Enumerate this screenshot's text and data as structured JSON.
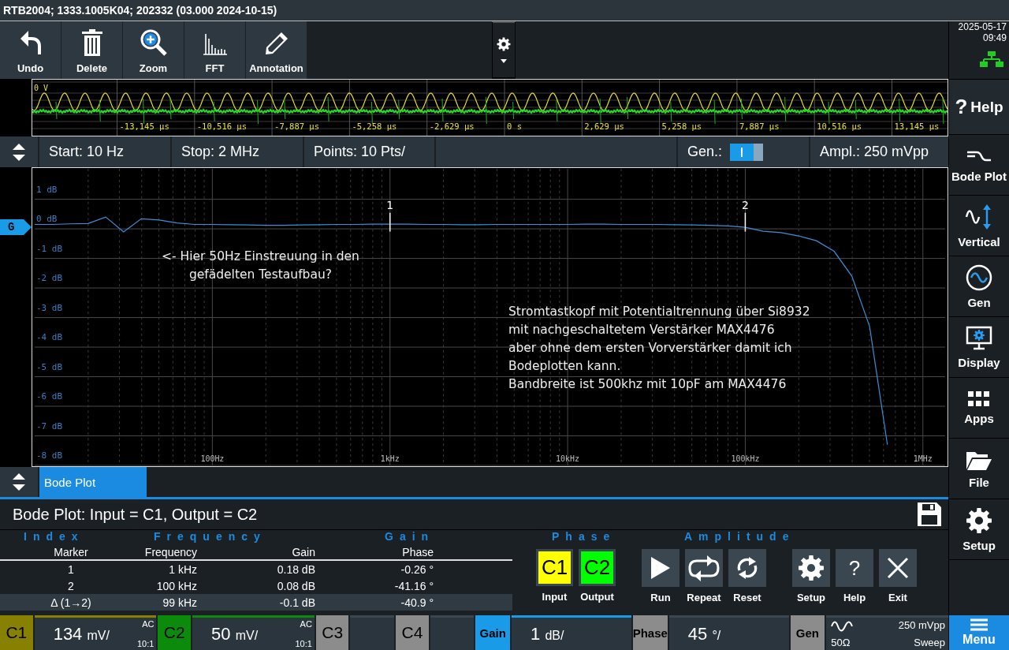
{
  "title": "RTB2004; 1333.1005K04; 202332 (03.000 2024-10-15)",
  "toolbar": {
    "buttons": [
      "Undo",
      "Delete",
      "Zoom",
      "FFT",
      "Annotation"
    ]
  },
  "overview": {
    "level_label": "0 V",
    "time_labels": [
      "-13,145 µs",
      "-10,516 µs",
      "-7,887 µs",
      "-5,258 µs",
      "-2,629 µs",
      "0 s",
      "2,629 µs",
      "5,258 µs",
      "7,887 µs",
      "10,516 µs",
      "13,145 µs"
    ]
  },
  "settings": {
    "start": "Start: 10 Hz",
    "stop": "Stop: 2 MHz",
    "points": "Points: 10 Pts/",
    "gen_label": "Gen.:",
    "gen_on": true,
    "amplitude": "Ampl.: 250 mVpp"
  },
  "plot": {
    "chart_data": {
      "type": "line",
      "grid": true,
      "ylim": [
        -8,
        2.03
      ],
      "categories": [
        null,
        null,
        null,
        null,
        null,
        null,
        null,
        null,
        null,
        null,
        "100Hz",
        null,
        null,
        null,
        null,
        null,
        null,
        null,
        null,
        null,
        "1kHz",
        null,
        null,
        null,
        null,
        null,
        null,
        null,
        null,
        null,
        "10kHz",
        null,
        null,
        null,
        null,
        null,
        null,
        null,
        null,
        null,
        "100kHz",
        null,
        null,
        null,
        null,
        null,
        null,
        null,
        null,
        null,
        "1MHz",
        null
      ],
      "series": [
        {
          "name": "G",
          "color": "#3c8fd8",
          "values": [
            0.15,
            0.15,
            0.17,
            0.18,
            0.4,
            -0.1,
            0.34,
            0.3,
            0.2,
            0.15,
            0.15,
            0.14,
            0.13,
            0.12,
            0.12,
            0.13,
            0.14,
            0.15,
            0.15,
            0.16,
            0.16,
            0.16,
            0.15,
            0.15,
            0.14,
            0.14,
            0.15,
            0.15,
            0.15,
            0.15,
            0.15,
            0.16,
            0.16,
            0.15,
            0.15,
            0.15,
            0.14,
            0.13,
            0.12,
            0.1,
            0.05,
            -0.08,
            -0.13,
            -0.24,
            -0.4,
            -0.76,
            -1.6,
            -3.3,
            -7.3,
            null,
            null,
            null
          ]
        }
      ],
      "yticks": [
        {
          "value": 1,
          "label": "1 dB"
        },
        {
          "value": 0,
          "label": "0 dB"
        },
        {
          "value": -1,
          "label": "-1 dB"
        },
        {
          "value": -2,
          "label": "-2 dB"
        },
        {
          "value": -3,
          "label": "-3 dB"
        },
        {
          "value": -4,
          "label": "-4 dB"
        },
        {
          "value": -5,
          "label": "-5 dB"
        },
        {
          "value": -6,
          "label": "-6 dB"
        },
        {
          "value": -7,
          "label": "-7 dB"
        },
        {
          "value": -8,
          "label": "-8 dB"
        }
      ]
    },
    "markers": [
      {
        "label": "1"
      },
      {
        "label": "2"
      }
    ],
    "notes": [
      {
        "lines": [
          "<- Hier 50Hz Einstreuung in den",
          "gefädelten Testaufbau?"
        ]
      },
      {
        "lines": [
          "Stromtastkopf mit Potentialtrennung über Si8932",
          "mit nachgeschaltetem Verstärker MAX4476",
          "aber ohne dem ersten Vorverstärker damit ich",
          "Bodeplotten kann.",
          "Bandbreite ist 500khz mit 10pF am MAX4476"
        ]
      }
    ]
  },
  "tabs": [
    {
      "label": "Bode Plot",
      "selected": true
    }
  ],
  "panel": {
    "title": "Bode Plot: Input = C1, Output = C2",
    "section_labels": [
      "Index",
      "Frequency",
      "Gain",
      "Phase",
      "Amplitude"
    ],
    "table": {
      "columns": [
        "Marker",
        "Frequency",
        "Gain",
        "Phase"
      ],
      "rows": [
        {
          "cells": [
            "1",
            "1 kHz",
            "0.18 dB",
            "-0.26 °"
          ],
          "selected": false
        },
        {
          "cells": [
            "2",
            "100 kHz",
            "0.08 dB",
            "-41.16 °"
          ],
          "selected": false
        },
        {
          "cells": [
            "Δ (1→2)",
            "99 kHz",
            "-0.1 dB",
            "-40.9 °"
          ],
          "selected": true
        }
      ]
    },
    "sources": [
      {
        "name": "C1",
        "label": "Input",
        "color": "#ffff00"
      },
      {
        "name": "C2",
        "label": "Output",
        "color": "#00ff00"
      }
    ],
    "actions": [
      {
        "kind": "run",
        "label": "Run"
      },
      {
        "kind": "repeat",
        "label": "Repeat"
      },
      {
        "kind": "reset",
        "label": "Reset"
      },
      {
        "kind": "setup",
        "label": "Setup"
      },
      {
        "kind": "help",
        "label": "Help",
        "glyph": "?"
      },
      {
        "kind": "exit",
        "label": "Exit"
      }
    ]
  },
  "channels": [
    {
      "name": "C1",
      "value": "134",
      "unit": "mV/",
      "coupling": "AC",
      "probe": "10:1",
      "color": "#878000",
      "active": true
    },
    {
      "name": "C2",
      "value": "50",
      "unit": "mV/",
      "coupling": "AC",
      "probe": "10:1",
      "color": "#0b8a0b",
      "active": true
    },
    {
      "name": "C3",
      "color": "#8c8c8c",
      "active": false
    },
    {
      "name": "C4",
      "color": "#8c8c8c",
      "active": false
    },
    {
      "name": "Gain",
      "value": "1",
      "unit": "dB/",
      "color": "#1a9be8",
      "active": true
    },
    {
      "name": "Phase",
      "value": "45",
      "unit": "°/",
      "color": "#8c8c8c",
      "active": false
    }
  ],
  "generator": {
    "name": "Gen",
    "impedance": "50Ω",
    "amplitude": "250 mVpp",
    "mode": "Sweep"
  },
  "sidebar": {
    "date": "2025-05-17",
    "time": "09:49",
    "items": [
      {
        "label": "Help",
        "glyph": "?"
      },
      {
        "label": "Bode Plot"
      },
      {
        "label": "Vertical"
      },
      {
        "label": "Gen"
      },
      {
        "label": "Display"
      },
      {
        "label": "Apps"
      },
      {
        "label": "File"
      },
      {
        "label": "Setup"
      }
    ],
    "menu": "Menu"
  }
}
